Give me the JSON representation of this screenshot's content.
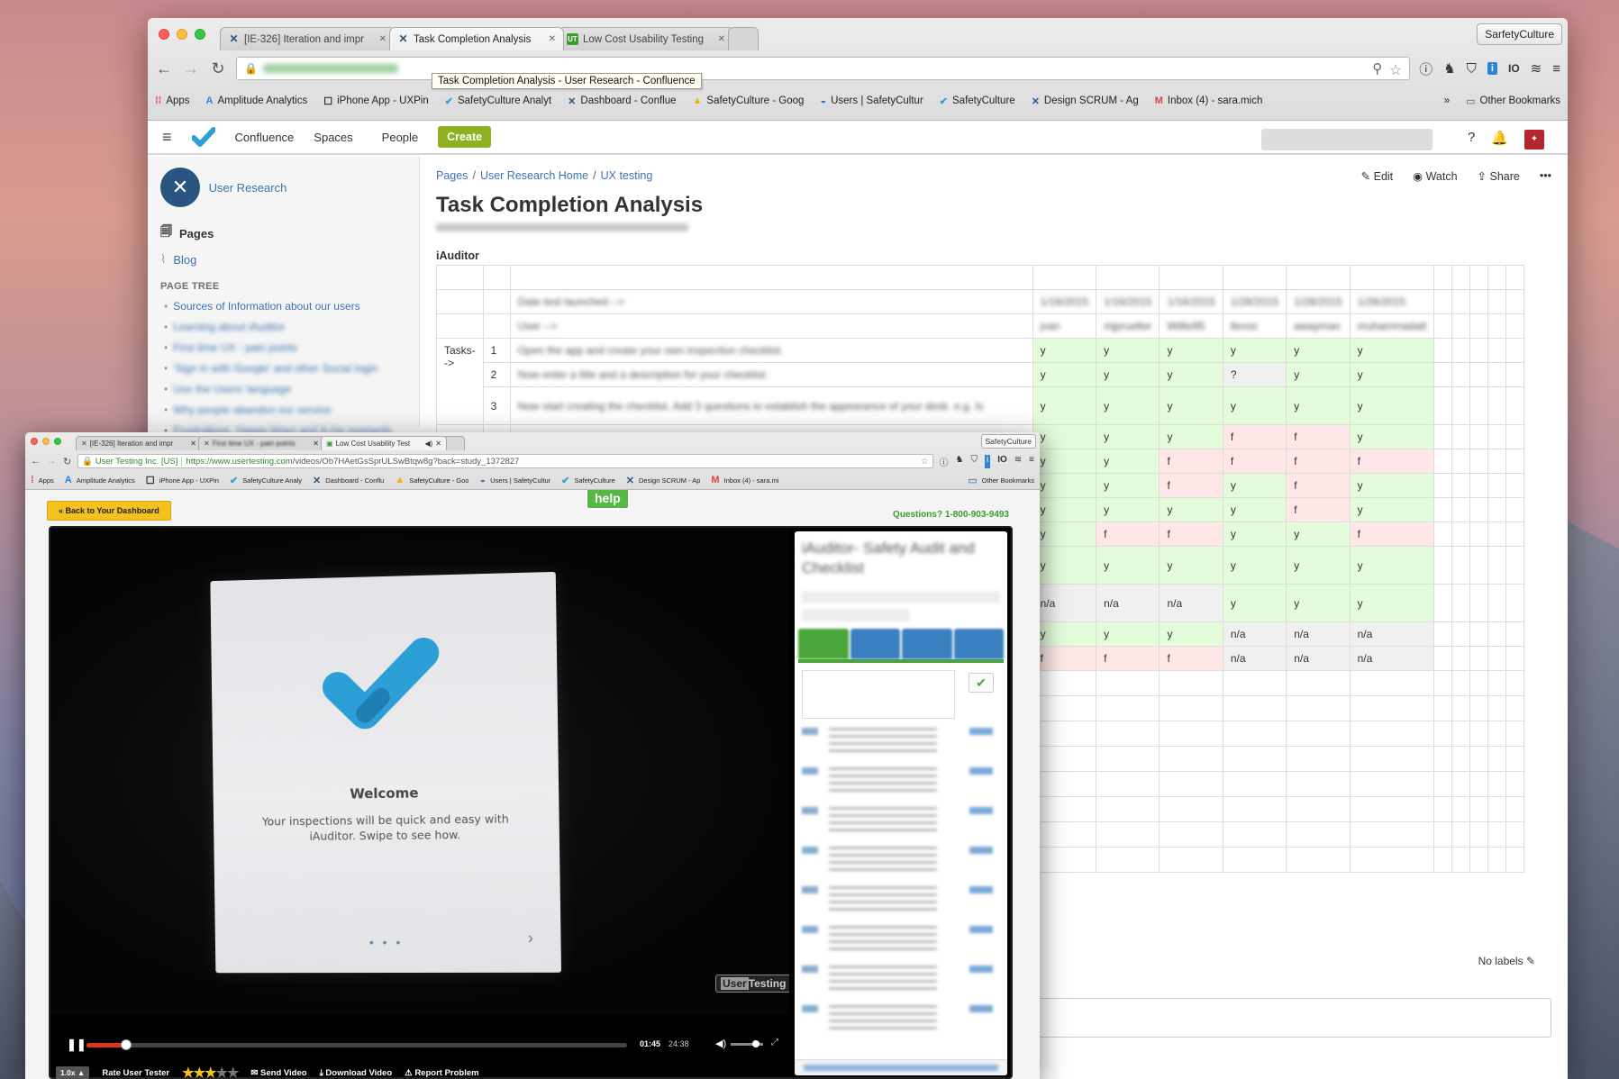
{
  "back_window": {
    "tabs": [
      {
        "icon": "jira-icon",
        "title": "[IE-326] Iteration and impr"
      },
      {
        "icon": "confluence-icon",
        "title": "Task Completion Analysis"
      },
      {
        "icon": "ut-icon",
        "title": "Low Cost Usability Testing"
      }
    ],
    "profile_name": "SarfetyCulture",
    "tooltip": "Task Completion Analysis - User Research - Confluence",
    "bookmarks": [
      {
        "icon": "apps-icon",
        "label": "Apps"
      },
      {
        "icon": "amplitude-icon",
        "label": "Amplitude Analytics"
      },
      {
        "icon": "page-icon",
        "label": "iPhone App - UXPin"
      },
      {
        "icon": "safetyculture-icon",
        "label": "SafetyCulture Analyt"
      },
      {
        "icon": "confluence-icon",
        "label": "Dashboard - Conflue"
      },
      {
        "icon": "drive-icon",
        "label": "SafetyCulture - Goog"
      },
      {
        "icon": "users-icon",
        "label": "Users | SafetyCultur"
      },
      {
        "icon": "safetyculture-icon",
        "label": "SafetyCulture"
      },
      {
        "icon": "jira-icon",
        "label": "Design SCRUM - Ag"
      },
      {
        "icon": "gmail-icon",
        "label": "Inbox (4) - sara.mich"
      }
    ],
    "bookmarks_overflow": "»",
    "other_bookmarks": "Other Bookmarks",
    "confluence": {
      "nav": [
        "Confluence",
        "Spaces",
        "People"
      ],
      "create_label": "Create",
      "space_name": "User Research",
      "sidebar_pages": "Pages",
      "sidebar_blog": "Blog",
      "page_tree_heading": "PAGE TREE",
      "page_tree": [
        "Sources of Information about our users",
        "Learning about iAuditor",
        "First time UX - pain points",
        "'Sign in with Google' and other Social login",
        "Use the Users' language",
        "Why people abandon our service",
        "Frustrations, Happy times and A-Ha moments"
      ],
      "breadcrumbs": [
        "Pages",
        "User Research Home",
        "UX testing"
      ],
      "actions": {
        "edit": "Edit",
        "watch": "Watch",
        "share": "Share",
        "more": "•••"
      },
      "page_title": "Task Completion Analysis",
      "section_heading": "iAuditor",
      "table": {
        "date_label": "Date test launched -->",
        "user_label": "User -->",
        "tasks_label": "Tasks-->",
        "dates": [
          "1/16/2015",
          "1/16/2015",
          "1/16/2015",
          "1/28/2015",
          "1/28/2015",
          "1/28/2015"
        ],
        "users": [
          "jvan",
          "mjpruelter",
          "Willie95",
          "llevoc",
          "awayman",
          "muhammadatt"
        ],
        "task_rows": [
          {
            "num": "1",
            "task": "Open the app and create your own inspection checklist.",
            "results": [
              "y",
              "y",
              "y",
              "y",
              "y",
              "y"
            ]
          },
          {
            "num": "2",
            "task": "Now enter a title and a description for your checklist.",
            "results": [
              "y",
              "y",
              "y",
              "?",
              "y",
              "y"
            ]
          },
          {
            "num": "3",
            "task": "Now start creating the checklist. Add 3 questions to establish the appearance of your desk. e.g. Is",
            "results": [
              "y",
              "y",
              "y",
              "y",
              "y",
              "y"
            ]
          }
        ],
        "hidden_rows": [
          [
            "y",
            "y",
            "y",
            "f",
            "f",
            "y"
          ],
          [
            "y",
            "y",
            "f",
            "f",
            "f",
            "f"
          ],
          [
            "y",
            "y",
            "f",
            "y",
            "f",
            "y"
          ],
          [
            "y",
            "y",
            "y",
            "y",
            "f",
            "y"
          ],
          [
            "y",
            "f",
            "f",
            "y",
            "y",
            "f"
          ],
          [
            "y",
            "y",
            "y",
            "y",
            "y",
            "y"
          ],
          [
            "n/a",
            "n/a",
            "n/a",
            "y",
            "y",
            "y"
          ],
          [
            "y",
            "y",
            "y",
            "n/a",
            "n/a",
            "n/a"
          ],
          [
            "f",
            "f",
            "f",
            "n/a",
            "n/a",
            "n/a"
          ]
        ]
      },
      "no_labels": "No labels"
    }
  },
  "front_window": {
    "tabs": [
      {
        "icon": "jira-icon",
        "title": "[IE-326] Iteration and impr"
      },
      {
        "icon": "confluence-icon",
        "title": "First time UX - pain points"
      },
      {
        "icon": "ut-icon",
        "title": "Low Cost Usability Test"
      }
    ],
    "profile_name": "SafetyCulture",
    "ev_label": "User Testing Inc. [US]",
    "url_secure": "https://www.usertesting.com",
    "url_path": "/videos/Ob7HAetGsSprULSwBtqw8g?back=study_1372827",
    "bookmarks": [
      {
        "icon": "apps-icon",
        "label": "Apps"
      },
      {
        "icon": "amplitude-icon",
        "label": "Amplitude Analytics"
      },
      {
        "icon": "page-icon",
        "label": "iPhone App - UXPin"
      },
      {
        "icon": "safetyculture-icon",
        "label": "SafetyCulture Analy"
      },
      {
        "icon": "confluence-icon",
        "label": "Dashboard - Conflu"
      },
      {
        "icon": "drive-icon",
        "label": "SafetyCulture - Goo"
      },
      {
        "icon": "users-icon",
        "label": "Users | SafetyCultur"
      },
      {
        "icon": "safetyculture-icon",
        "label": "SafetyCulture"
      },
      {
        "icon": "jira-icon",
        "label": "Design SCRUM - Ap"
      },
      {
        "icon": "gmail-icon",
        "label": "Inbox (4) - sara.mi"
      }
    ],
    "other_bookmarks": "Other Bookmarks",
    "back_to_dashboard": "« Back to Your Dashboard",
    "help_label": "help",
    "questions": "Questions? 1-800-903-9493",
    "video": {
      "welcome_title": "Welcome",
      "welcome_text": "Your inspections will be quick and easy with iAuditor. Swipe to see how.",
      "dots": "• • •",
      "watermark_a": "User",
      "watermark_b": "Testing",
      "brand_color": "#2c9fd6",
      "progress_fraction": 0.073
    },
    "controls": {
      "current_time": "01:45",
      "total_time": "24:38",
      "speed": "1.0x",
      "rate_label": "Rate User Tester",
      "rating": 3,
      "rating_max": 5,
      "send_video": "Send Video",
      "download_video": "Download Video",
      "report_problem": "Report Problem"
    },
    "side_panel": {
      "title": "iAuditor- Safety Audit and Checklist"
    }
  }
}
